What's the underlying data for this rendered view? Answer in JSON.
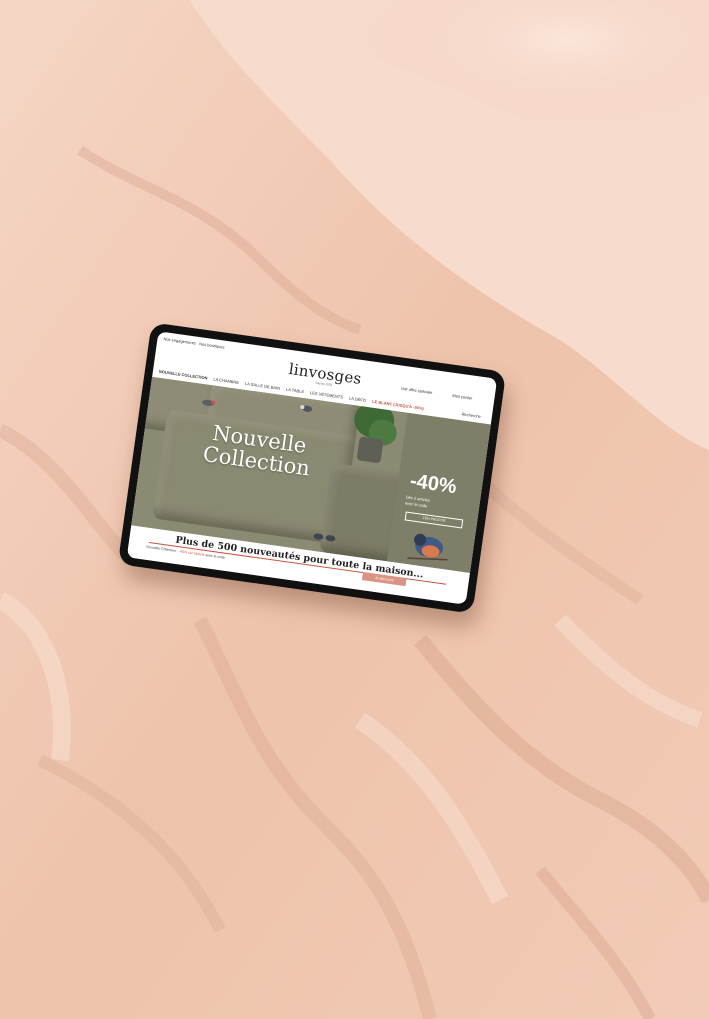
{
  "scene": {
    "description_colors": {
      "fabric": "#f0cbb5",
      "tablet_frame": "#111111",
      "accent": "#c8553d"
    }
  },
  "site": {
    "topbar": {
      "left1": "Nos engagements",
      "left2": "Nos boutiques"
    },
    "logo": "linvosges",
    "tagline": "Depuis 1923",
    "account": {
      "offer": "Voir offre spéciale",
      "cart": "Mon panier"
    },
    "nav": {
      "items": [
        "NOUVELLE COLLECTION",
        "LA CHAMBRE",
        "LA SALLE DE BAIN",
        "LA TABLE",
        "LES VÊTEMENTS",
        "LA DÉCO"
      ],
      "promo": "LE BLANC (JUSQU'À -50%)",
      "search": "Recherche"
    },
    "hero": {
      "title_line1": "Nouvelle",
      "title_line2": "Collection",
      "discount": "-40%",
      "discount_line1": "Dès 2 articles",
      "discount_line2": "avec le code",
      "discount_button": "J'EN PROFITE"
    },
    "headline": "Plus de 500 nouveautés pour toute la maison...",
    "sub_text_1": "Nouvelle Collection : ",
    "sub_text_red": "-40% sur l'article",
    "sub_text_2": " avec le code ",
    "cta": "Je découvre"
  }
}
